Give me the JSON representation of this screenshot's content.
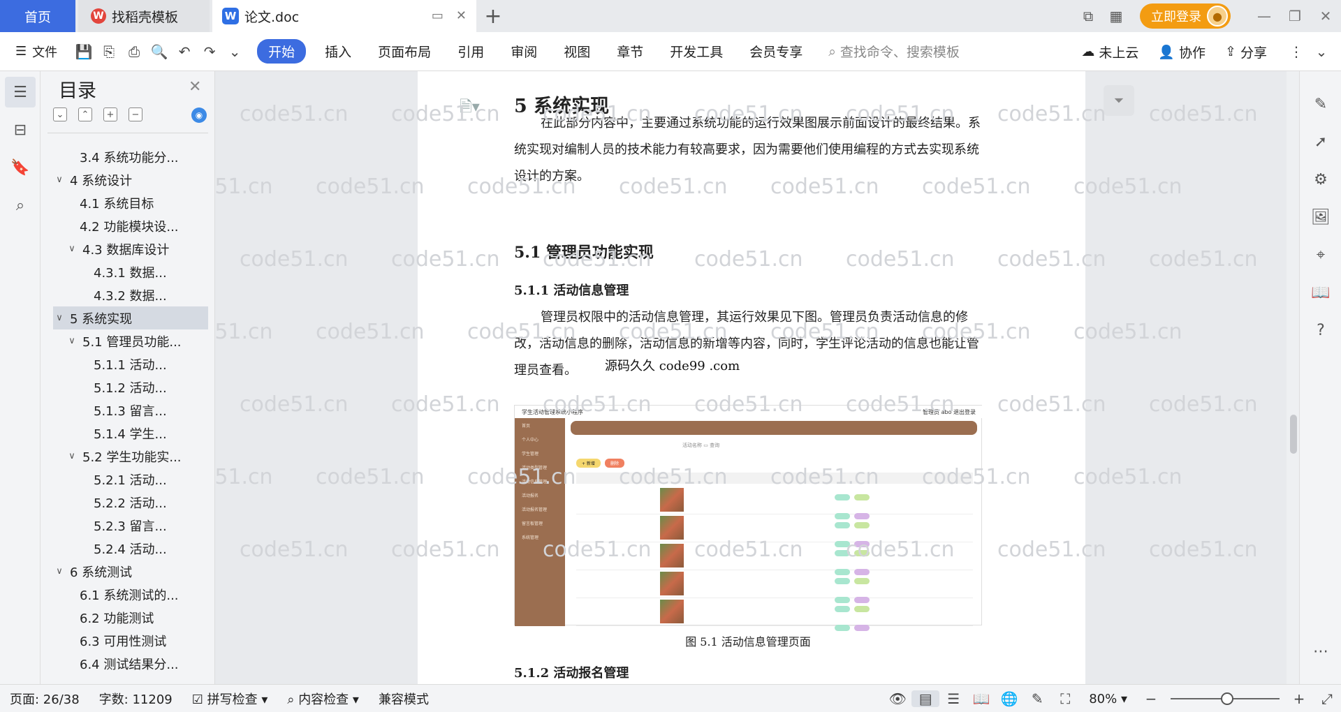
{
  "tabs": {
    "home": "首页",
    "docer": "找稻壳模板",
    "docer_icon": "docer-icon",
    "doc": "论文.doc",
    "add": "+"
  },
  "titlebar": {
    "login": "立即登录"
  },
  "ribbon": {
    "file": "文件",
    "tabs": [
      "开始",
      "插入",
      "页面布局",
      "引用",
      "审阅",
      "视图",
      "章节",
      "开发工具",
      "会员专享"
    ],
    "search_placeholder": "查找命令、搜索模板",
    "cloud": "未上云",
    "collab": "协作",
    "share": "分享"
  },
  "toc": {
    "title": "目录",
    "items": [
      {
        "label": "3.4 系统功能分...",
        "level": 1,
        "expandable": false
      },
      {
        "label": "4 系统设计",
        "level": 0,
        "expandable": true
      },
      {
        "label": "4.1 系统目标",
        "level": 1,
        "expandable": false
      },
      {
        "label": "4.2 功能模块设...",
        "level": 1,
        "expandable": false
      },
      {
        "label": "4.3 数据库设计",
        "level": 1,
        "expandable": true
      },
      {
        "label": "4.3.1 数据...",
        "level": 2,
        "expandable": false
      },
      {
        "label": "4.3.2 数据...",
        "level": 2,
        "expandable": false
      },
      {
        "label": "5 系统实现",
        "level": 0,
        "expandable": true,
        "selected": true
      },
      {
        "label": "5.1 管理员功能...",
        "level": 1,
        "expandable": true
      },
      {
        "label": "5.1.1 活动...",
        "level": 2,
        "expandable": false
      },
      {
        "label": "5.1.2 活动...",
        "level": 2,
        "expandable": false
      },
      {
        "label": "5.1.3 留言...",
        "level": 2,
        "expandable": false
      },
      {
        "label": "5.1.4 学生...",
        "level": 2,
        "expandable": false
      },
      {
        "label": "5.2 学生功能实...",
        "level": 1,
        "expandable": true
      },
      {
        "label": "5.2.1 活动...",
        "level": 2,
        "expandable": false
      },
      {
        "label": "5.2.2 活动...",
        "level": 2,
        "expandable": false
      },
      {
        "label": "5.2.3 留言...",
        "level": 2,
        "expandable": false
      },
      {
        "label": "5.2.4 活动...",
        "level": 2,
        "expandable": false
      },
      {
        "label": "6 系统测试",
        "level": 0,
        "expandable": true
      },
      {
        "label": "6.1 系统测试的...",
        "level": 1,
        "expandable": false
      },
      {
        "label": "6.2 功能测试",
        "level": 1,
        "expandable": false
      },
      {
        "label": "6.3 可用性测试",
        "level": 1,
        "expandable": false
      },
      {
        "label": "6.4 测试结果分...",
        "level": 1,
        "expandable": false
      }
    ]
  },
  "document": {
    "heading1": "5  系统实现",
    "para1": "在此部分内容中，主要通过系统功能的运行效果图展示前面设计的最终结果。系统实现对编制人员的技术能力有较高要求，因为需要他们使用编程的方式去实现系统设计的方案。",
    "heading2": "5.1  管理员功能实现",
    "heading3a": "5.1.1  活动信息管理",
    "para2": "管理员权限中的活动信息管理，其运行效果见下图。管理员负责活动信息的修改，活动信息的删除，活动信息的新增等内容，同时，学生评论活动的信息也能让管理员查看。",
    "overlap_text": "源码久久 code99 .com",
    "figure_title": "学生活动管理系统小程序",
    "figure_user": "管理员 abo    退出登录",
    "figure_menu": [
      "首页",
      "个人中心",
      "学生管理",
      "活动类型管理",
      "活动信息管理",
      "活动报名",
      "活动报名管理",
      "留言板管理",
      "系统管理"
    ],
    "caption": "图 5.1  活动信息管理页面",
    "heading3b": "5.1.2  活动报名管理",
    "watermark": "code51.cn"
  },
  "status": {
    "page": "页面: 26/38",
    "words": "字数: 11209",
    "spell": "拼写检查",
    "content": "内容检查",
    "compat": "兼容模式",
    "zoom": "80%"
  },
  "colors": {
    "accent": "#3c6ce0",
    "login": "#f39c12",
    "figure_brown": "#9b6e50"
  }
}
